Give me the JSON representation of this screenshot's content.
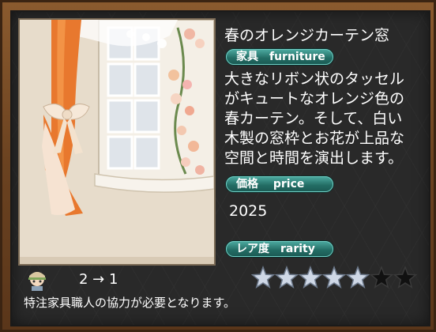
{
  "item": {
    "name": "春のオレンジカーテン窓",
    "description_lines": [
      "大きなリボン状のタッセル",
      "がキュートなオレンジ色の",
      "春カーテン。そして、白い",
      "木製の窓枠とお花が上品な",
      "空間と時間を演出します。"
    ],
    "price": "2025",
    "rarity_stars": 5,
    "rarity_max": 7
  },
  "tags": {
    "category": "家具　furniture",
    "price": "価格　 price",
    "rarity": "レア度　rarity"
  },
  "conversion": {
    "text": "2 → 1",
    "note": "特注家具職人の協力が必要となります。",
    "icon": "craftsman-icon"
  },
  "colors": {
    "curtain": "#e8782e",
    "tag_fill": "#2e8a80",
    "star_filled": "#cfd8e6",
    "star_empty": "#111111",
    "frame": "#6b4220"
  }
}
